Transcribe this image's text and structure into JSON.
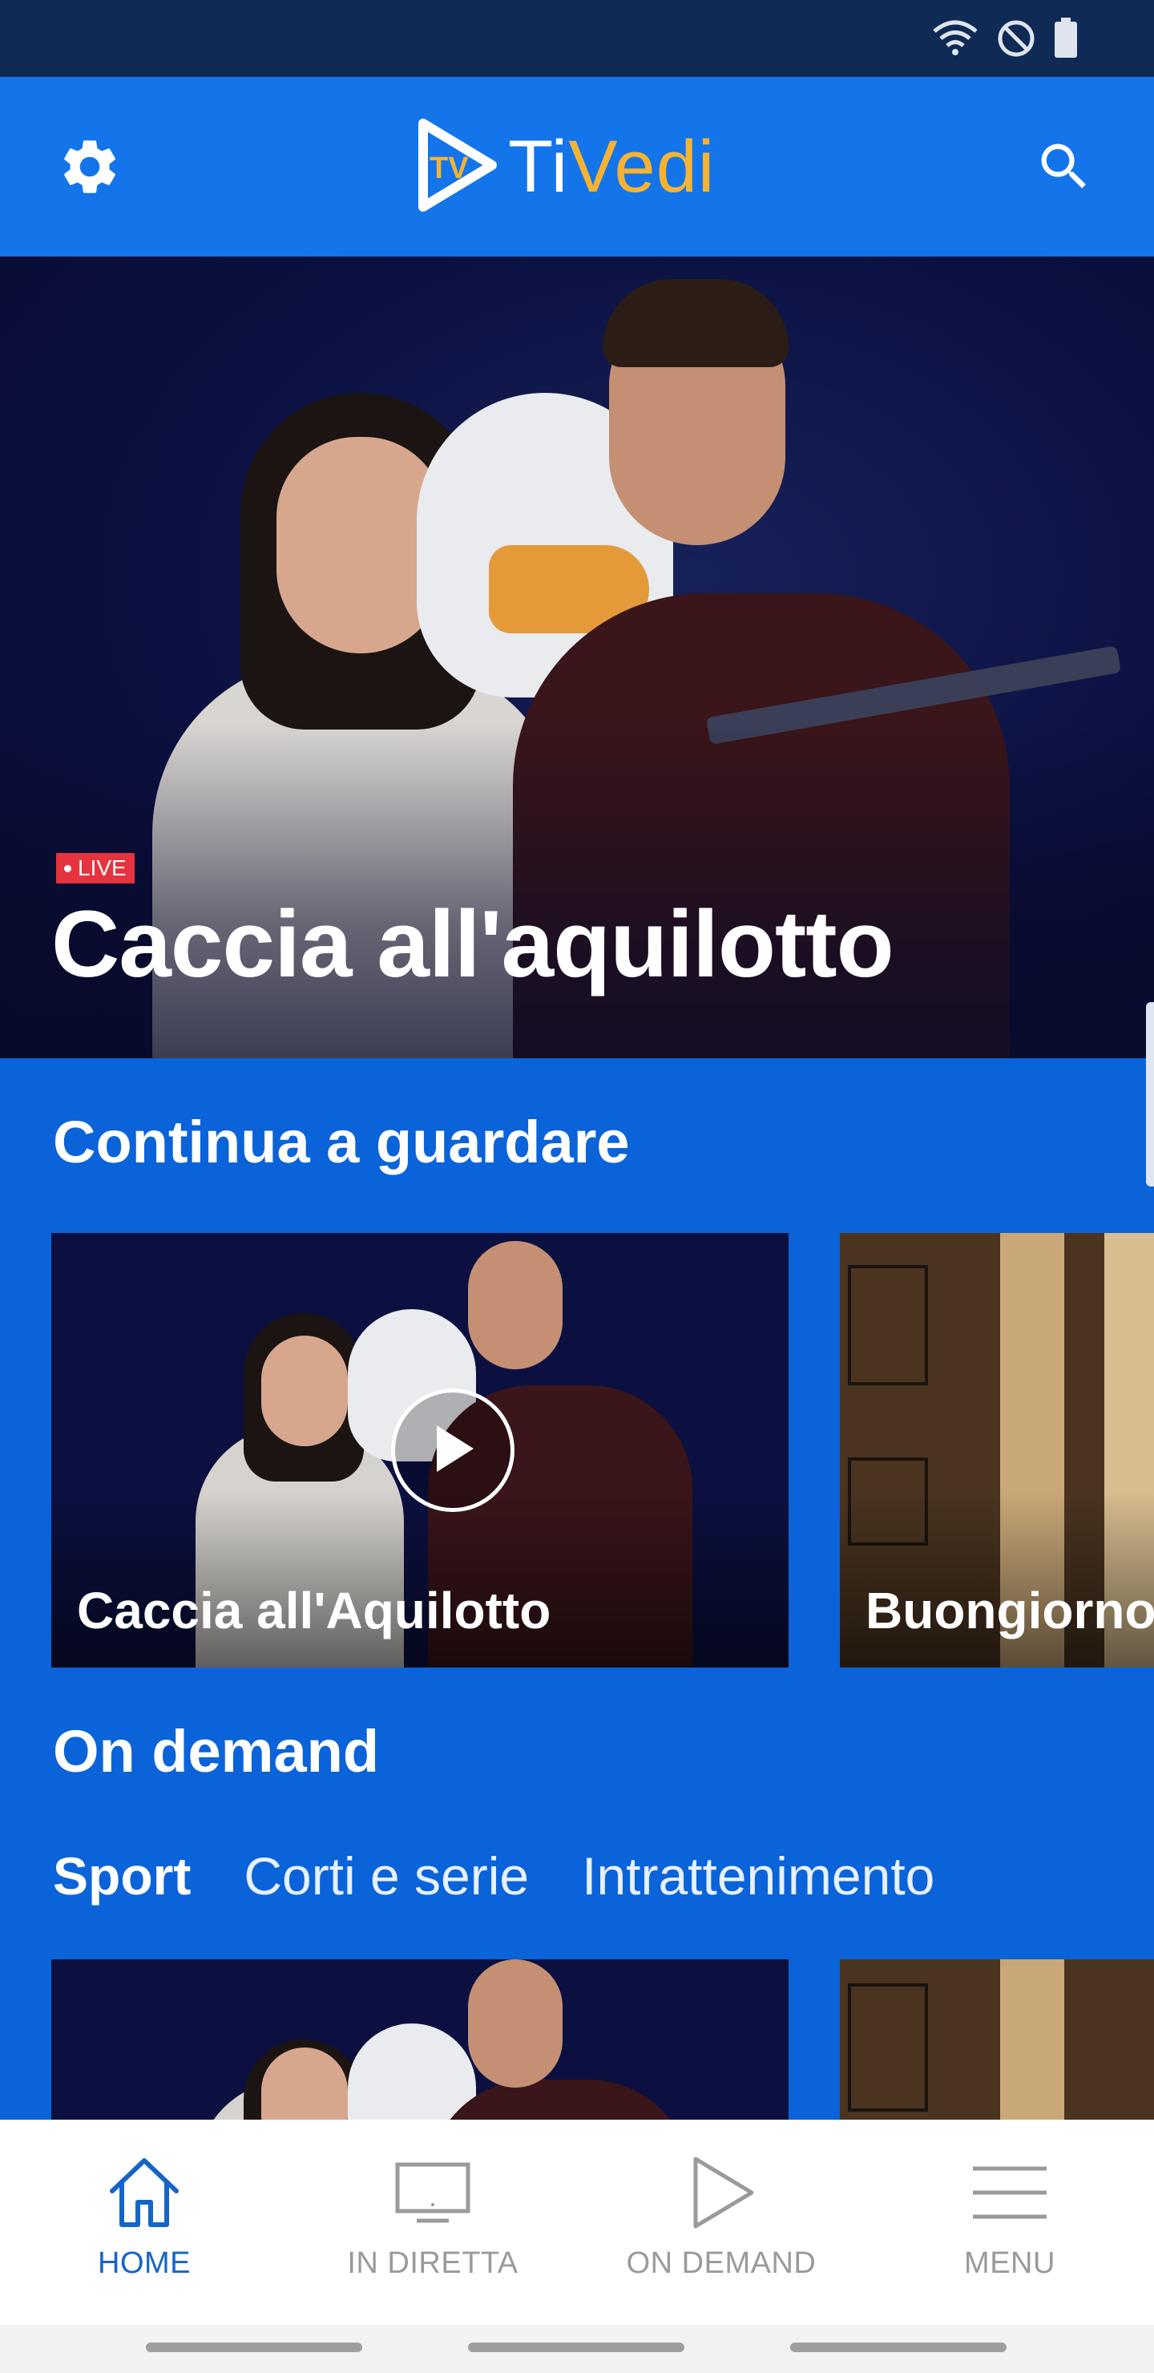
{
  "status_bar": {
    "icons": [
      "wifi-icon",
      "do-not-disturb-icon",
      "battery-icon"
    ]
  },
  "app_bar": {
    "logo_prefix": "Ti",
    "logo_suffix": "Vedi",
    "logo_badge": "TV",
    "settings_icon": "gear-icon",
    "search_icon": "search-icon",
    "colors": {
      "background": "#1474ea",
      "logo_accent": "#f6b332"
    }
  },
  "hero": {
    "badge": "LIVE",
    "title": "Caccia all'aquilotto"
  },
  "continue_watching": {
    "title": "Continua a guardare",
    "items": [
      {
        "label": "Caccia all'Aquilotto"
      },
      {
        "label": "Buongiorno"
      }
    ]
  },
  "on_demand": {
    "title": "On demand",
    "tabs": [
      {
        "label": "Sport",
        "active": true
      },
      {
        "label": "Corti e serie",
        "active": false
      },
      {
        "label": "Intrattenimento",
        "active": false
      }
    ]
  },
  "bottom_nav": {
    "items": [
      {
        "label": "HOME",
        "icon": "home-icon",
        "active": true
      },
      {
        "label": "IN DIRETTA",
        "icon": "tv-icon",
        "active": false
      },
      {
        "label": "ON DEMAND",
        "icon": "play-icon",
        "active": false
      },
      {
        "label": "MENU",
        "icon": "menu-icon",
        "active": false
      }
    ],
    "colors": {
      "active": "#1565c9",
      "inactive": "#9a9a9a"
    }
  }
}
